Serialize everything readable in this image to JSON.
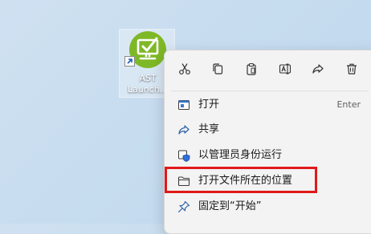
{
  "desktop": {
    "shortcut": {
      "label": "AST Launch...",
      "label_line1": "AST",
      "label_line2": "Launch...",
      "icon": "ast-launcher-app-icon",
      "brand_color": "#7fb827"
    }
  },
  "context_menu": {
    "toolbar": [
      {
        "name": "cut",
        "icon": "scissors-icon"
      },
      {
        "name": "copy",
        "icon": "copy-icon"
      },
      {
        "name": "paste",
        "icon": "clipboard-icon"
      },
      {
        "name": "rename",
        "icon": "rename-icon"
      },
      {
        "name": "share",
        "icon": "share-icon"
      },
      {
        "name": "delete",
        "icon": "trash-icon"
      }
    ],
    "items": [
      {
        "label": "打开",
        "shortcut": "Enter",
        "icon": "open-icon"
      },
      {
        "label": "共享",
        "icon": "share-icon"
      },
      {
        "label": "以管理员身份运行",
        "icon": "shield-icon"
      },
      {
        "label": "打开文件所在的位置",
        "icon": "folder-icon",
        "highlighted": true
      },
      {
        "label": "固定到“开始”",
        "icon": "pin-icon"
      }
    ],
    "highlight_color": "#e11919"
  }
}
